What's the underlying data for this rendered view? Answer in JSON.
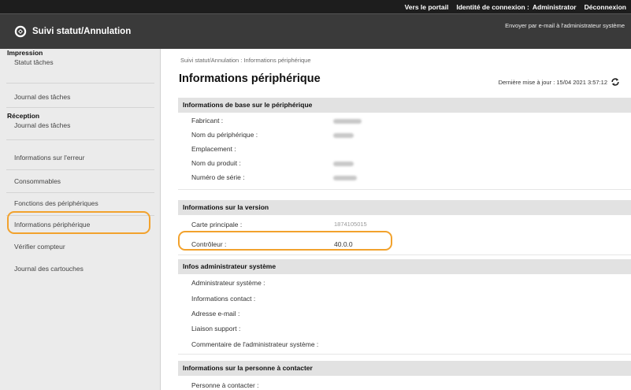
{
  "header": {
    "portal_link": "Vers le portail",
    "login_label": "Identité de connexion :",
    "login_user": "Administrator",
    "logout_link": "Déconnexion"
  },
  "app": {
    "title": "Suivi statut/Annulation",
    "email_link": "Envoyer par e-mail à l'administrateur système"
  },
  "sidebar": {
    "impression_title": "Impression",
    "impression_items": [
      "Statut tâches",
      "Journal des tâches"
    ],
    "reception_title": "Réception",
    "reception_items": [
      "Journal des tâches"
    ],
    "items": [
      "Informations sur l'erreur",
      "Consommables",
      "Fonctions des périphériques",
      "Informations périphérique",
      "Vérifier compteur",
      "Journal des cartouches"
    ],
    "selected": "Informations périphérique"
  },
  "main": {
    "breadcrumb": "Suivi statut/Annulation : Informations périphérique",
    "title": "Informations périphérique",
    "last_update": "Dernière mise à jour : 15/04 2021 3:57:12",
    "sections": {
      "basic": {
        "title": "Informations de base sur le périphérique",
        "labels": [
          "Fabricant :",
          "Nom du périphérique :",
          "Emplacement :",
          "Nom du produit :",
          "Numéro de série :"
        ]
      },
      "version": {
        "title": "Informations sur la version",
        "rows": [
          {
            "label": "Carte principale :",
            "value": "1874105015"
          },
          {
            "label": "Contrôleur :",
            "value": "40.0.0"
          }
        ]
      },
      "admin": {
        "title": "Infos administrateur système",
        "labels": [
          "Administrateur système :",
          "Informations contact :",
          "Adresse e-mail :",
          "Liaison support :",
          "Commentaire de l'administrateur système :"
        ]
      },
      "contact": {
        "title": "Informations sur la personne à contacter",
        "labels": [
          "Personne à contacter :"
        ]
      }
    }
  },
  "colors": {
    "highlight": "#f2a22d",
    "topbar": "#1d1d1d",
    "titlebar": "#3a3a3a"
  }
}
